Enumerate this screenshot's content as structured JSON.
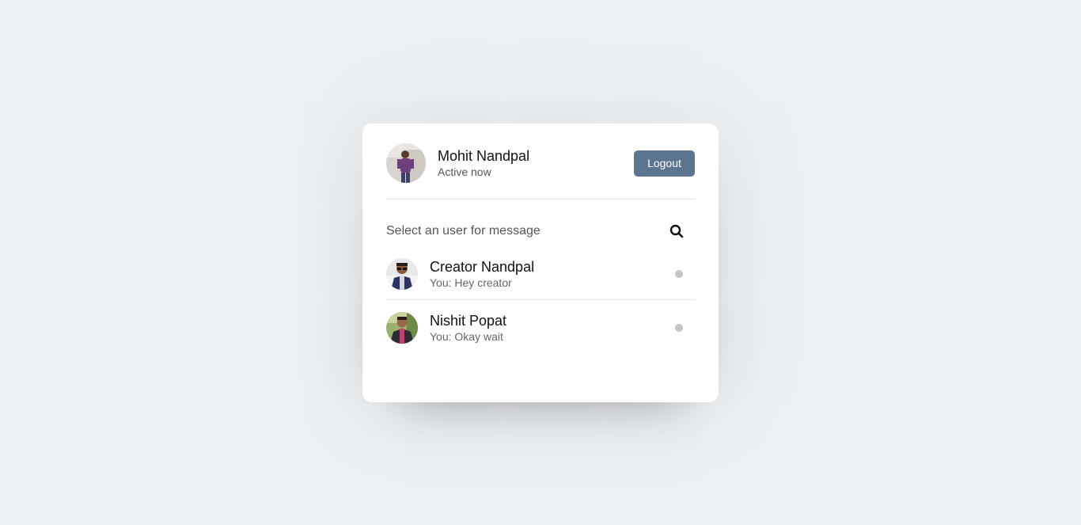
{
  "current_user": {
    "name": "Mohit Nandpal",
    "status": "Active now",
    "logout_label": "Logout"
  },
  "search": {
    "text": "Select an user for message",
    "icon": "search-icon"
  },
  "users": [
    {
      "name": "Creator Nandpal",
      "last_message": "You: Hey creator",
      "status": "offline",
      "status_color": "#c6c6c6"
    },
    {
      "name": "Nishit Popat",
      "last_message": "You: Okay wait",
      "status": "offline",
      "status_color": "#c6c6c6"
    }
  ],
  "colors": {
    "background": "#edf1f4",
    "logout_button": "#5b7590",
    "offline_dot": "#c6c6c6"
  }
}
